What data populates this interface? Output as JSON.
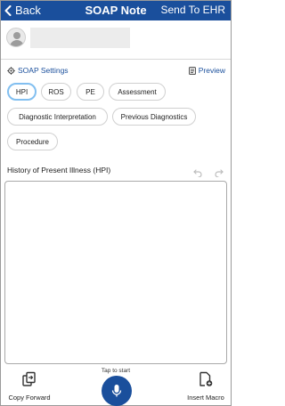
{
  "nav": {
    "back_label": "Back",
    "title": "SOAP Note",
    "send_label": "Send To EHR"
  },
  "patient": {
    "name": ""
  },
  "settings": {
    "soap_settings_label": "SOAP Settings",
    "preview_label": "Preview"
  },
  "chips": [
    {
      "label": "HPI",
      "active": true
    },
    {
      "label": "ROS",
      "active": false
    },
    {
      "label": "PE",
      "active": false
    },
    {
      "label": "Assessment",
      "active": false
    },
    {
      "label": "Diagnostic Interpretation",
      "active": false
    },
    {
      "label": "Previous Diagnostics",
      "active": false
    },
    {
      "label": "Procedure",
      "active": false
    }
  ],
  "section": {
    "title": "History of Present Illness (HPI)",
    "text": ""
  },
  "bottom": {
    "copy_forward_label": "Copy Forward",
    "tap_to_start_label": "Tap to start",
    "insert_macro_label": "Insert Macro"
  },
  "colors": {
    "brand": "#1a4f9c",
    "active_chip_border": "#82bff0"
  },
  "icons": {
    "back": "chevron-left-icon",
    "settings": "gear-icon",
    "preview": "document-icon",
    "undo": "undo-icon",
    "redo": "redo-icon",
    "copy_forward": "copy-forward-icon",
    "mic": "microphone-icon",
    "insert_macro": "insert-macro-icon",
    "avatar": "user-avatar-icon"
  }
}
